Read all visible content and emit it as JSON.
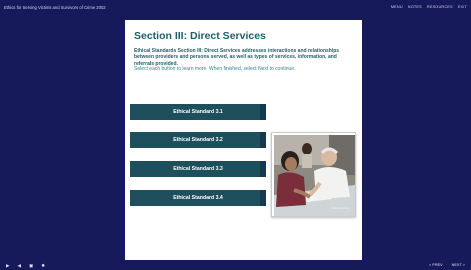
{
  "header": {
    "course_title": "Ethics for Serving Victims and Survivors of Crime 2002",
    "menu": [
      "MENU",
      "NOTES",
      "RESOURCES",
      "EXIT"
    ]
  },
  "slide": {
    "title": "Section III:  Direct Services",
    "intro": "Ethical Standards Section III: Direct Services addresses interactions and relationships between providers and persons served, as well as types of services, information, and referrals provided.",
    "instruction": "Select each button to learn more. When finished, select Next to continue.",
    "buttons": [
      "Ethical Standard 3.1",
      "Ethical Standard 3.2",
      "Ethical Standard 3.3",
      "Ethical Standard 3.4"
    ],
    "photo_credit": "©iStockphoto"
  },
  "footer": {
    "controls": {
      "play_icon": "play-icon",
      "volume_icon": "volume-icon",
      "captions_icon": "captions-icon",
      "settings_icon": "settings-icon"
    },
    "prev_label": "< PREV",
    "next_label": "NEXT >"
  },
  "colors": {
    "background": "#16195a",
    "button": "#1d4f5c",
    "title": "#1f5f6e"
  }
}
